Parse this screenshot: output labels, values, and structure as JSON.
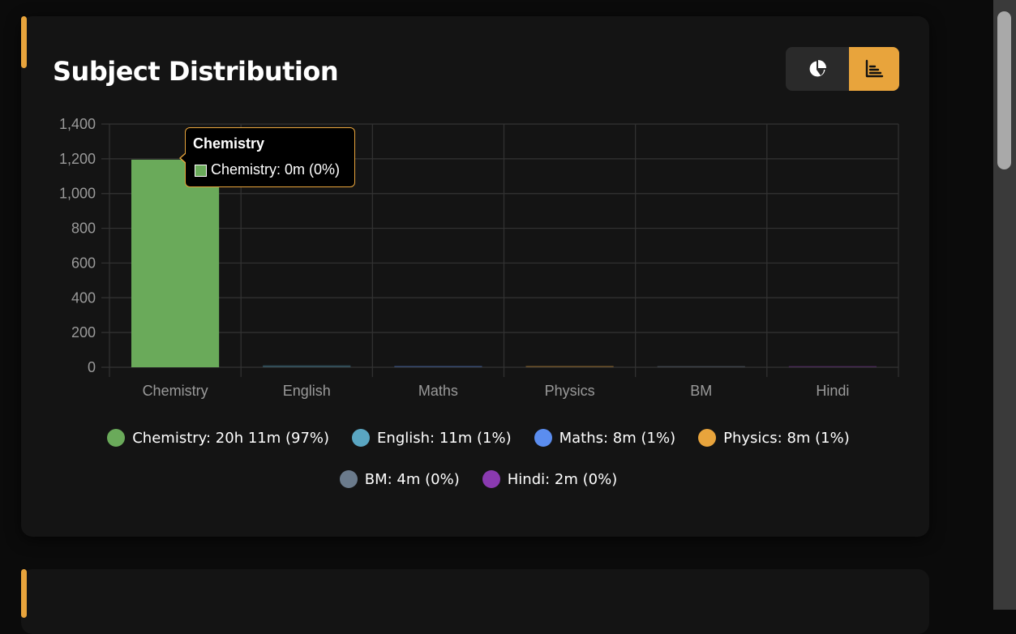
{
  "card": {
    "title": "Subject Distribution",
    "toggle": {
      "pie_icon": "pie-chart-icon",
      "bar_icon": "bar-chart-icon",
      "active": "bar"
    }
  },
  "colors": {
    "accent": "#e8a43c",
    "background": "#141414"
  },
  "chart_data": {
    "type": "bar",
    "title": "",
    "xlabel": "",
    "ylabel": "",
    "categories": [
      "Chemistry",
      "English",
      "Maths",
      "Physics",
      "BM",
      "Hindi"
    ],
    "values": [
      1195,
      11,
      8,
      8,
      4,
      2
    ],
    "colors": [
      "#6aaa5a",
      "#5aa6c2",
      "#5b8def",
      "#e8a43c",
      "#6b7b8c",
      "#8a3ab0"
    ],
    "ylim": [
      0,
      1400
    ],
    "yticks": [
      "0",
      "200",
      "400",
      "600",
      "800",
      "1,000",
      "1,200",
      "1,400"
    ],
    "grid": true,
    "legend_position": "bottom"
  },
  "tooltip": {
    "title": "Chemistry",
    "body": "Chemistry: 0m (0%)"
  },
  "legend": {
    "row1": [
      {
        "label": "Chemistry: 20h 11m (97%)",
        "color": "#6aaa5a"
      },
      {
        "label": "English: 11m (1%)",
        "color": "#5aa6c2"
      },
      {
        "label": "Maths: 8m (1%)",
        "color": "#5b8def"
      },
      {
        "label": "Physics: 8m (1%)",
        "color": "#e8a43c"
      }
    ],
    "row2": [
      {
        "label": "BM: 4m (0%)",
        "color": "#6b7b8c"
      },
      {
        "label": "Hindi: 2m (0%)",
        "color": "#8a3ab0"
      }
    ]
  }
}
